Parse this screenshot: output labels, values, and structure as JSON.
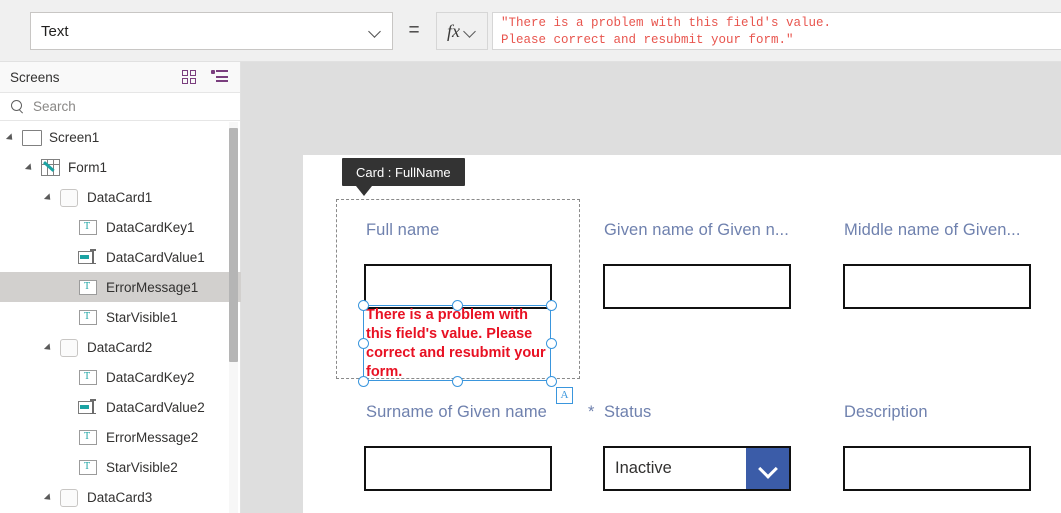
{
  "property_bar": {
    "selected_property": "Text",
    "equals_sign": "=",
    "fx_label": "fx",
    "formula": "\"There is a problem with this field's value.\nPlease correct and resubmit your form.\""
  },
  "tree_panel": {
    "title": "Screens",
    "thumbnail_view_icon": "grid-view-icon",
    "tree_view_icon": "tree-view-icon",
    "search_placeholder": "Search",
    "search_icon": "search-icon",
    "items": [
      {
        "label": "Screen1",
        "icon": "screen-icon",
        "depth": 0,
        "expanded": true,
        "selected": false
      },
      {
        "label": "Form1",
        "icon": "form-icon",
        "depth": 1,
        "expanded": true,
        "selected": false
      },
      {
        "label": "DataCard1",
        "icon": "card-icon",
        "depth": 2,
        "expanded": true,
        "selected": false
      },
      {
        "label": "DataCardKey1",
        "icon": "label-icon",
        "depth": 3,
        "expanded": false,
        "selected": false
      },
      {
        "label": "DataCardValue1",
        "icon": "text-input-icon",
        "depth": 3,
        "expanded": false,
        "selected": false
      },
      {
        "label": "ErrorMessage1",
        "icon": "label-icon",
        "depth": 3,
        "expanded": false,
        "selected": true
      },
      {
        "label": "StarVisible1",
        "icon": "label-icon",
        "depth": 3,
        "expanded": false,
        "selected": false
      },
      {
        "label": "DataCard2",
        "icon": "card-icon",
        "depth": 2,
        "expanded": true,
        "selected": false
      },
      {
        "label": "DataCardKey2",
        "icon": "label-icon",
        "depth": 3,
        "expanded": false,
        "selected": false
      },
      {
        "label": "DataCardValue2",
        "icon": "text-input-icon",
        "depth": 3,
        "expanded": false,
        "selected": false
      },
      {
        "label": "ErrorMessage2",
        "icon": "label-icon",
        "depth": 3,
        "expanded": false,
        "selected": false
      },
      {
        "label": "StarVisible2",
        "icon": "label-icon",
        "depth": 3,
        "expanded": false,
        "selected": false
      },
      {
        "label": "DataCard3",
        "icon": "card-icon",
        "depth": 2,
        "expanded": true,
        "selected": false
      }
    ]
  },
  "canvas": {
    "tooltip": "Card : FullName",
    "fields": [
      {
        "label": "Full name",
        "required": false
      },
      {
        "label": "Given name of Given n...",
        "required": false
      },
      {
        "label": "Middle name of Given...",
        "required": false
      },
      {
        "label": "Surname of Given name",
        "required": false
      },
      {
        "label": "Status",
        "required": true,
        "required_marker": "*"
      },
      {
        "label": "Description",
        "required": false
      }
    ],
    "error_message": "There is a problem with this field's value.  Please correct and resubmit your form.",
    "dropdown_value": "Inactive",
    "dropdown_chevron_icon": "chevron-down-icon",
    "alignment_badge": "A"
  },
  "colors": {
    "label_blue": "#6f81ae",
    "error_red": "#e81123",
    "formula_red": "#e8554e",
    "selection_blue": "#3a96dd",
    "dropdown_blue": "#3b5ca8",
    "accent_purple": "#7a3e7e",
    "icon_teal": "#1ba3a3"
  }
}
